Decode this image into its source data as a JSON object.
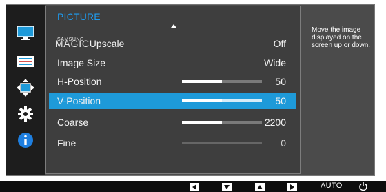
{
  "menu": {
    "title": "PICTURE",
    "items": [
      {
        "brand_small": "SAMSUNG",
        "brand_big": "MAGIC",
        "label": "Upscale",
        "value": "Off"
      },
      {
        "label": "Image Size",
        "value": "Wide"
      },
      {
        "label": "H-Position",
        "value": "50",
        "level": 0.5
      },
      {
        "label": "V-Position",
        "value": "50",
        "level": 0.5,
        "selected": true
      },
      {
        "label": "Coarse",
        "value": "2200",
        "level": 0.5
      },
      {
        "label": "Fine",
        "value": "0",
        "level": 0.0
      }
    ]
  },
  "help": {
    "text": "Move the image displayed on the screen up or down."
  },
  "sidebar": {
    "icons": [
      "monitor-icon",
      "display-settings-icon",
      "position-arrows-icon",
      "gear-icon",
      "info-icon"
    ]
  },
  "buttons": {
    "items": [
      "left-arrow-icon",
      "down-arrow-icon",
      "up-arrow-icon",
      "right-arrow-icon"
    ],
    "auto_label": "AUTO",
    "power_icon": "power-icon"
  },
  "colors": {
    "accent": "#1e9ad9",
    "title": "#1e9cf0",
    "panel": "#3e3e3e",
    "background": "#4b4b4b"
  }
}
